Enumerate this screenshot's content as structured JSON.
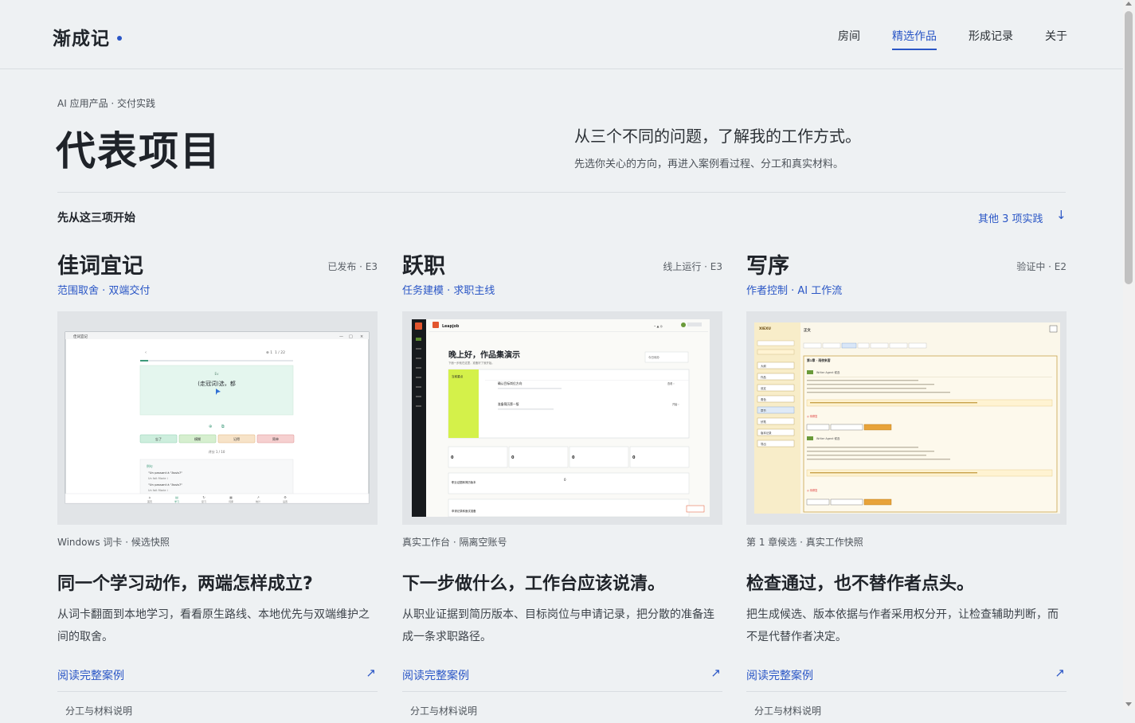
{
  "header": {
    "logo": "渐成记",
    "nav": [
      "房间",
      "精选作品",
      "形成记录",
      "关于"
    ],
    "active_nav": "精选作品"
  },
  "hero": {
    "eyebrow": "AI 应用产品 · 交付实践",
    "title": "代表项目",
    "lead": "从三个不同的问题，了解我的工作方式。",
    "sublead": "先选你关心的方向，再进入案例看过程、分工和真实材料。"
  },
  "section": {
    "title": "先从这三项开始",
    "more_link": "其他 3 项实践",
    "more_icon": "arrow-down-icon"
  },
  "cards": [
    {
      "title": "佳词宜记",
      "status": "已发布 · E3",
      "tags": "范围取舍 · 双端交付",
      "caption": "Windows 词卡 · 候选快照",
      "question": "同一个学习动作，两端怎样成立?",
      "desc": "从词卡翻面到本地学习，看看原生路线、本地优先与双端维护之间的取舍。",
      "link": "阅读完整案例",
      "next": "分工与材料说明",
      "shot": {
        "window_title": "佳词宜记",
        "progress": "1 / 22",
        "card_hint": "Ev",
        "card_word": "(走冠词)选，都",
        "buttons": [
          "忘了",
          "模糊",
          "记得",
          "简单"
        ],
        "status": "评分 1 / 10",
        "example_label": "例句",
        "examples": [
          "\"Un passant à \"Assis?\"",
          "Un fait Marie i",
          "\"Un passant à \"Assis?\"",
          "Un fait Marie i"
        ],
        "tabs": [
          "首页",
          "学习",
          "复习",
          "词库",
          "统计",
          "设置"
        ],
        "button_colors": [
          "#cdeedd",
          "#d6efcf",
          "#f7e3c8",
          "#f6d0d0"
        ]
      }
    },
    {
      "title": "跃职",
      "status": "线上运行 · E3",
      "tags": "任务建模 · 求职主线",
      "caption": "真实工作台 · 隔离空账号",
      "question": "下一步做什么，工作台应该说清。",
      "desc": "从职业证据到简历版本、目标岗位与申请记录，把分散的准备连成一条求职路径。",
      "link": "阅读完整案例",
      "next": "分工与材料说明",
      "shot": {
        "app_name": "Leapjob",
        "greeting": "晚上好，作品集演示",
        "sub": "下面一步就在这里，准备好了就开始。",
        "focus_label": "当前重点",
        "tasks": [
          "确认目标岗位方向",
          "准备简历第一版"
        ],
        "stats": [
          "0",
          "0",
          "0",
          "0"
        ],
        "widget": "今日待办",
        "panel_title": "职业证据和简历版本",
        "bottom_title": "申请记录和面试准备",
        "accent": "#d4f14a"
      }
    },
    {
      "title": "写序",
      "status": "验证中 · E2",
      "tags": "作者控制 · AI 工作流",
      "caption": "第 1 章候选 · 真实工作快照",
      "question": "检查通过，也不替作者点头。",
      "desc": "把生成候选、版本依据与作者采用权分开，让检查辅助判断，而不是代替作者决定。",
      "link": "阅读完整案例",
      "next": "分工与材料说明",
      "shot": {
        "app_name": "XIEXU",
        "panel_title": "正文",
        "chapter": "第1章 · 雨夜来客",
        "agent": "Writer Agent 候选",
        "sidebar_items": [
          "大纲",
          "作品",
          "设定",
          "角色",
          "章节",
          "伏笔",
          "版本记录",
          "导出"
        ],
        "accent": "#f5e3a3"
      }
    }
  ]
}
